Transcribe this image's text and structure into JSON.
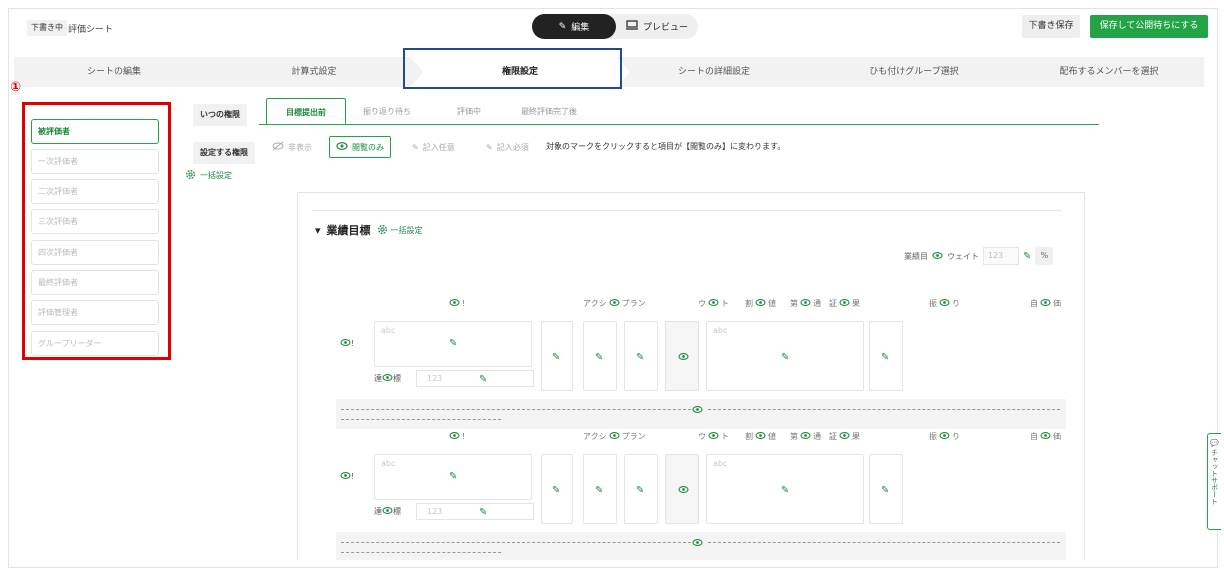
{
  "header": {
    "status_badge": "下書き中",
    "doc_title": "評価シート",
    "mode_edit": "編集",
    "mode_preview": "プレビュー",
    "draft_save": "下書き保存",
    "publish": "保存して公開待ちにする"
  },
  "steps": [
    "シートの編集",
    "計算式設定",
    "権限設定",
    "シートの詳細設定",
    "ひも付けグループ選択",
    "配布するメンバーを選択"
  ],
  "marker": "①",
  "roles": [
    "被評価者",
    "一次評価者",
    "二次評価者",
    "三次評価者",
    "四次評価者",
    "最終評価者",
    "評価管理者",
    "グループリーダー"
  ],
  "timing": {
    "label": "いつの権限",
    "tabs": [
      "目標提出前",
      "振り返り待ち",
      "評価中",
      "最終評価完了後"
    ]
  },
  "permission": {
    "label": "設定する権限",
    "options": [
      "非表示",
      "閲覧のみ",
      "記入任意",
      "記入必須"
    ],
    "note": "対象のマークをクリックすると項目が【閲覧のみ】に変わります。",
    "bulk": "一括設定"
  },
  "section": {
    "title": "業績目標",
    "bulk": "一括設定",
    "weight_label_a": "業績目",
    "weight_label_b": "ウェイト",
    "weight_placeholder": "123",
    "pct": "%"
  },
  "columns": {
    "c1": "!",
    "c2a": "アクシ",
    "c2b": "プラン",
    "c3a": "ウ",
    "c3b": "ト",
    "c4a": "割",
    "c4b": "値",
    "c5a": "第",
    "c5b": "通",
    "c6a": "証",
    "c6b": "果",
    "c7a": "振",
    "c7b": "り",
    "c8a": "自",
    "c8b": "価"
  },
  "rows": [
    {
      "label_a": "!",
      "label_b": "",
      "placeholder": "abc",
      "sub_a": "達",
      "sub_b": "標",
      "sub_placeholder": "123"
    },
    {
      "label_a": "!",
      "label_b": "!",
      "placeholder": "abc",
      "sub_a": "達",
      "sub_b": "標",
      "sub_placeholder": "123"
    }
  ],
  "chat": "チャットサポート",
  "colors": {
    "accent": "#22a446",
    "dark": "#222222",
    "highlight_red": "#e00000",
    "highlight_blue": "#1f4c8a"
  }
}
